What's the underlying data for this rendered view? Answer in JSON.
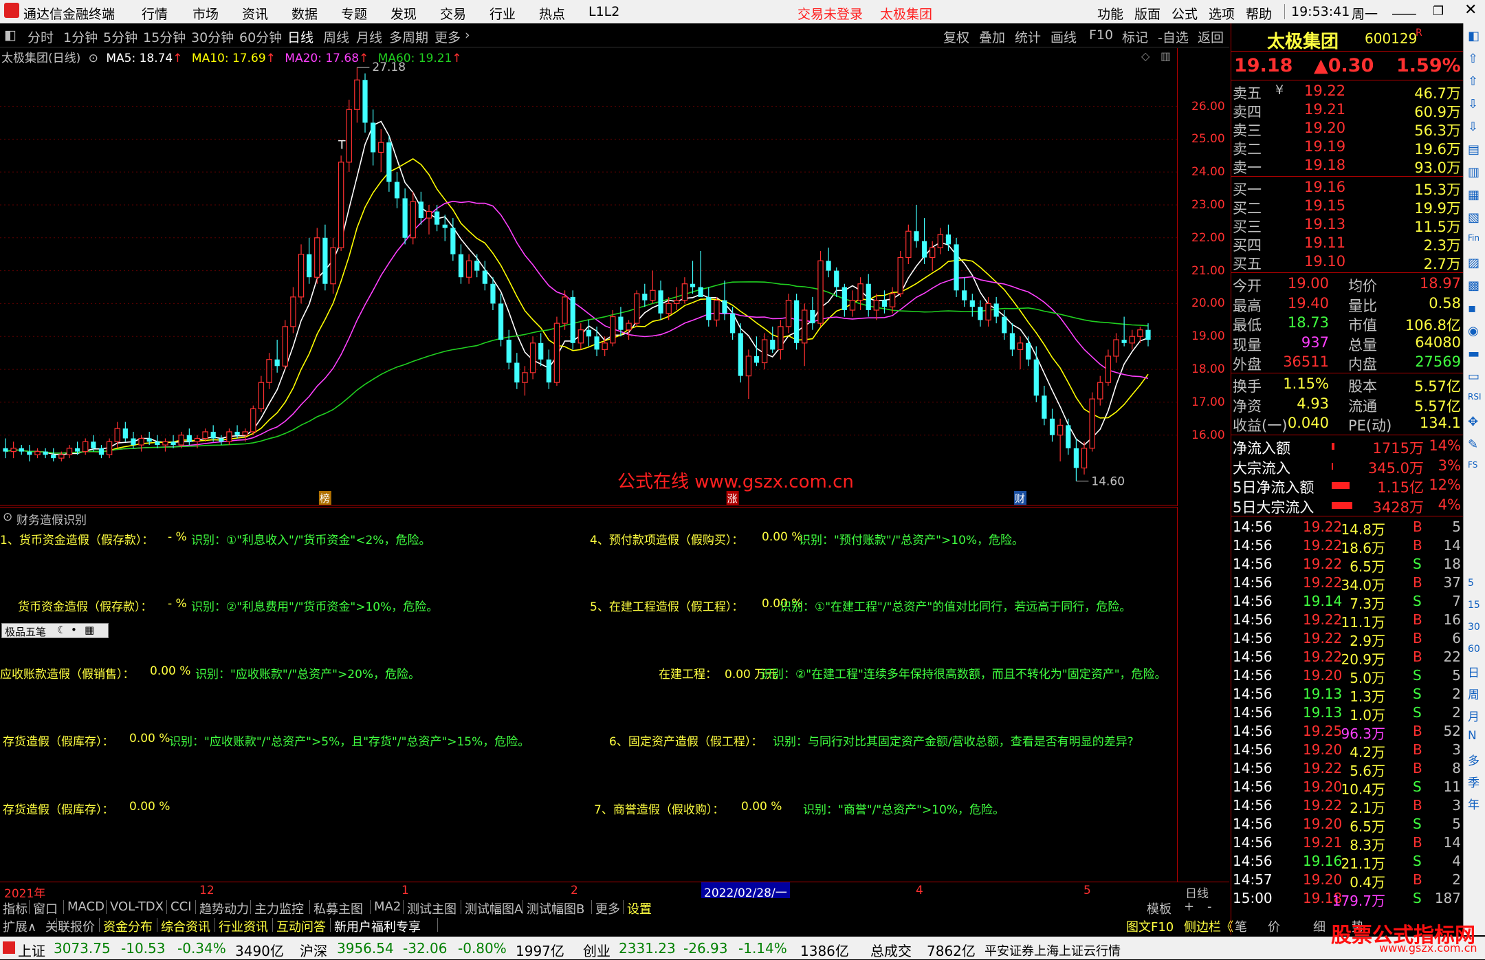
{
  "titlebar": {
    "app_title": "通达信金融终端",
    "menu": [
      "行情",
      "市场",
      "资讯",
      "数据",
      "专题",
      "发现",
      "交易",
      "行业",
      "热点",
      "L1L2"
    ],
    "login_status": "交易未登录",
    "stock_name": "太极集团",
    "right_menu": [
      "功能",
      "版面",
      "公式",
      "选项",
      "帮助"
    ],
    "time": "19:53:41",
    "weekday": "周一"
  },
  "periodbar": {
    "periods": [
      "分时",
      "1分钟",
      "5分钟",
      "15分钟",
      "30分钟",
      "60分钟",
      "日线",
      "周线",
      "月线",
      "多周期",
      "更多"
    ],
    "selected": "日线",
    "right_tools": [
      "复权",
      "叠加",
      "统计",
      "画线",
      "F10",
      "标记",
      "-自选",
      "返回"
    ]
  },
  "chart": {
    "info_name": "太极集团(日线)",
    "ma5": "MA5: 18.74",
    "ma10": "MA10: 17.69",
    "ma20": "MA20: 17.68",
    "ma60": "MA60: 19.21",
    "high_label": "27.18",
    "low_label": "14.60",
    "watermark_text": "公式在线  www.gszx.com.cn",
    "markers": [
      "榜",
      "涨",
      "财"
    ],
    "colors": {
      "up": "#ff3030",
      "down": "#40ffff",
      "ma5": "#ffffff",
      "ma10": "#ffff00",
      "ma20": "#ff40ff",
      "ma60": "#20d020"
    }
  },
  "chart_data": {
    "type": "candlestick",
    "title": "太极集团(日线)",
    "ylim": [
      15.0,
      27.5
    ],
    "yticks": [
      "26.00",
      "25.00",
      "24.00",
      "23.00",
      "22.00",
      "21.00",
      "20.00",
      "19.00",
      "18.00",
      "17.00",
      "16.00"
    ],
    "xticks": [
      "2021年",
      "12",
      "1",
      "2",
      "2022/02/28/一",
      "4",
      "5"
    ],
    "candles": [
      [
        15.6,
        15.9,
        15.3,
        15.5
      ],
      [
        15.5,
        15.8,
        15.3,
        15.6
      ],
      [
        15.6,
        15.7,
        15.4,
        15.5
      ],
      [
        15.5,
        15.7,
        15.2,
        15.4
      ],
      [
        15.4,
        15.6,
        15.3,
        15.5
      ],
      [
        15.5,
        15.6,
        15.3,
        15.4
      ],
      [
        15.4,
        15.6,
        15.2,
        15.3
      ],
      [
        15.3,
        15.5,
        15.2,
        15.4
      ],
      [
        15.4,
        15.7,
        15.3,
        15.6
      ],
      [
        15.6,
        15.8,
        15.4,
        15.5
      ],
      [
        15.5,
        15.9,
        15.4,
        15.8
      ],
      [
        15.8,
        16.0,
        15.5,
        15.6
      ],
      [
        15.6,
        15.7,
        15.3,
        15.4
      ],
      [
        15.4,
        15.9,
        15.3,
        15.8
      ],
      [
        15.8,
        16.4,
        15.6,
        16.2
      ],
      [
        16.2,
        16.4,
        15.8,
        15.9
      ],
      [
        15.9,
        16.1,
        15.6,
        15.7
      ],
      [
        15.7,
        16.0,
        15.5,
        15.9
      ],
      [
        15.9,
        16.1,
        15.7,
        15.8
      ],
      [
        15.8,
        16.0,
        15.6,
        15.7
      ],
      [
        15.7,
        15.9,
        15.5,
        15.8
      ],
      [
        15.8,
        16.0,
        15.6,
        15.7
      ],
      [
        15.7,
        16.1,
        15.6,
        16.0
      ],
      [
        16.0,
        16.2,
        15.7,
        15.8
      ],
      [
        15.8,
        16.0,
        15.6,
        15.9
      ],
      [
        15.9,
        16.2,
        15.8,
        16.1
      ],
      [
        16.1,
        16.3,
        15.8,
        15.9
      ],
      [
        15.9,
        16.0,
        15.7,
        15.8
      ],
      [
        15.8,
        16.2,
        15.7,
        16.1
      ],
      [
        16.1,
        16.3,
        15.9,
        16.0
      ],
      [
        16.0,
        16.2,
        15.8,
        16.1
      ],
      [
        16.1,
        16.9,
        16.0,
        16.8
      ],
      [
        16.8,
        17.8,
        16.7,
        17.6
      ],
      [
        17.6,
        18.5,
        17.4,
        18.3
      ],
      [
        18.3,
        18.9,
        17.9,
        18.1
      ],
      [
        18.1,
        19.5,
        18.0,
        19.3
      ],
      [
        19.3,
        20.5,
        19.1,
        20.2
      ],
      [
        20.2,
        21.8,
        20.0,
        21.5
      ],
      [
        21.5,
        22.0,
        20.6,
        20.8
      ],
      [
        20.8,
        22.3,
        20.6,
        22.0
      ],
      [
        22.0,
        22.4,
        20.4,
        20.6
      ],
      [
        20.6,
        22.0,
        20.3,
        21.7
      ],
      [
        21.7,
        24.5,
        21.6,
        24.3
      ],
      [
        24.3,
        26.2,
        24.0,
        25.9
      ],
      [
        25.9,
        27.18,
        25.5,
        26.8
      ],
      [
        26.8,
        27.0,
        25.2,
        25.5
      ],
      [
        25.5,
        25.9,
        24.2,
        24.6
      ],
      [
        24.6,
        25.3,
        24.0,
        24.9
      ],
      [
        24.9,
        25.1,
        23.4,
        23.7
      ],
      [
        23.7,
        24.0,
        22.9,
        23.2
      ],
      [
        23.2,
        23.5,
        21.8,
        22.0
      ],
      [
        22.0,
        23.4,
        21.8,
        23.1
      ],
      [
        23.1,
        23.4,
        22.4,
        22.6
      ],
      [
        22.6,
        23.0,
        22.1,
        22.8
      ],
      [
        22.8,
        23.0,
        22.2,
        22.4
      ],
      [
        22.4,
        22.7,
        21.9,
        22.3
      ],
      [
        22.3,
        22.6,
        21.3,
        21.5
      ],
      [
        21.5,
        21.8,
        20.6,
        20.8
      ],
      [
        20.8,
        21.5,
        20.6,
        21.3
      ],
      [
        21.3,
        21.5,
        20.8,
        21.0
      ],
      [
        21.0,
        21.3,
        20.4,
        20.6
      ],
      [
        20.6,
        20.8,
        19.8,
        20.0
      ],
      [
        20.0,
        20.3,
        18.7,
        18.9
      ],
      [
        18.9,
        19.2,
        18.0,
        18.2
      ],
      [
        18.2,
        18.5,
        17.4,
        17.6
      ],
      [
        17.6,
        18.1,
        17.2,
        17.9
      ],
      [
        17.9,
        19.0,
        17.7,
        18.8
      ],
      [
        18.8,
        19.1,
        18.1,
        18.3
      ],
      [
        18.3,
        18.6,
        17.4,
        17.6
      ],
      [
        17.6,
        19.6,
        17.5,
        19.4
      ],
      [
        19.4,
        20.4,
        19.2,
        20.2
      ],
      [
        20.2,
        20.4,
        18.6,
        18.8
      ],
      [
        18.8,
        19.4,
        18.6,
        19.2
      ],
      [
        19.2,
        19.5,
        18.7,
        19.0
      ],
      [
        19.0,
        19.3,
        18.4,
        18.6
      ],
      [
        18.6,
        19.0,
        18.4,
        18.8
      ],
      [
        18.8,
        19.8,
        18.7,
        19.6
      ],
      [
        19.6,
        19.9,
        19.0,
        19.2
      ],
      [
        19.2,
        19.5,
        18.9,
        19.4
      ],
      [
        19.4,
        20.4,
        19.3,
        20.3
      ],
      [
        20.3,
        20.6,
        19.9,
        20.1
      ],
      [
        20.1,
        21.0,
        20.0,
        20.4
      ],
      [
        20.4,
        20.7,
        19.5,
        19.7
      ],
      [
        19.7,
        20.2,
        19.5,
        20.0
      ],
      [
        20.0,
        20.5,
        19.8,
        20.1
      ],
      [
        20.1,
        20.8,
        20.0,
        20.6
      ],
      [
        20.6,
        21.3,
        20.3,
        20.5
      ],
      [
        20.5,
        21.6,
        20.4,
        20.2
      ],
      [
        20.2,
        20.5,
        19.3,
        19.5
      ],
      [
        19.5,
        20.2,
        19.3,
        20.1
      ],
      [
        20.1,
        20.7,
        19.5,
        19.7
      ],
      [
        19.7,
        19.9,
        18.9,
        19.1
      ],
      [
        19.1,
        19.4,
        17.6,
        17.8
      ],
      [
        17.8,
        18.6,
        17.1,
        18.4
      ],
      [
        18.4,
        19.0,
        18.1,
        18.2
      ],
      [
        18.2,
        19.1,
        18.0,
        18.9
      ],
      [
        18.9,
        19.3,
        18.5,
        18.6
      ],
      [
        18.6,
        19.5,
        18.3,
        19.3
      ],
      [
        19.3,
        20.3,
        19.1,
        20.1
      ],
      [
        20.1,
        20.3,
        18.6,
        18.8
      ],
      [
        18.8,
        20.0,
        18.1,
        19.8
      ],
      [
        19.8,
        20.2,
        19.2,
        19.4
      ],
      [
        19.4,
        21.6,
        19.3,
        21.3
      ],
      [
        21.3,
        21.7,
        20.8,
        21.0
      ],
      [
        21.0,
        21.1,
        20.2,
        20.5
      ],
      [
        20.5,
        20.6,
        19.6,
        19.8
      ],
      [
        19.8,
        20.4,
        19.6,
        20.1
      ],
      [
        20.1,
        20.8,
        19.8,
        20.6
      ],
      [
        20.6,
        20.9,
        19.6,
        19.8
      ],
      [
        19.8,
        20.3,
        19.5,
        20.1
      ],
      [
        20.1,
        20.4,
        19.7,
        19.9
      ],
      [
        19.9,
        20.5,
        19.7,
        20.3
      ],
      [
        20.3,
        21.6,
        20.2,
        21.4
      ],
      [
        21.4,
        22.4,
        21.2,
        22.2
      ],
      [
        22.2,
        23.0,
        21.7,
        21.9
      ],
      [
        21.9,
        22.6,
        21.2,
        21.4
      ],
      [
        21.4,
        21.9,
        21.0,
        21.7
      ],
      [
        21.7,
        22.3,
        21.5,
        22.1
      ],
      [
        22.1,
        22.4,
        21.6,
        21.8
      ],
      [
        21.8,
        22.0,
        20.2,
        20.4
      ],
      [
        20.4,
        20.8,
        19.9,
        20.1
      ],
      [
        20.1,
        20.3,
        19.6,
        19.9
      ],
      [
        19.9,
        20.1,
        19.3,
        19.5
      ],
      [
        19.5,
        20.2,
        19.3,
        20.0
      ],
      [
        20.0,
        20.2,
        19.4,
        19.6
      ],
      [
        19.6,
        19.8,
        18.9,
        19.1
      ],
      [
        19.1,
        19.4,
        18.4,
        18.6
      ],
      [
        18.6,
        19.0,
        18.0,
        18.8
      ],
      [
        18.8,
        19.0,
        18.1,
        18.3
      ],
      [
        18.3,
        18.7,
        17.0,
        17.2
      ],
      [
        17.2,
        17.5,
        16.3,
        16.5
      ],
      [
        16.5,
        16.8,
        15.8,
        16.0
      ],
      [
        16.0,
        16.5,
        15.2,
        16.3
      ],
      [
        16.3,
        16.5,
        15.4,
        15.6
      ],
      [
        15.6,
        15.9,
        14.6,
        15.0
      ],
      [
        15.0,
        15.8,
        14.8,
        15.6
      ],
      [
        15.6,
        17.3,
        15.5,
        17.1
      ],
      [
        17.1,
        17.8,
        16.9,
        17.6
      ],
      [
        17.6,
        18.6,
        17.5,
        18.4
      ],
      [
        18.4,
        19.1,
        18.2,
        18.9
      ],
      [
        18.9,
        19.6,
        18.7,
        18.8
      ],
      [
        18.8,
        19.2,
        18.6,
        19.0
      ],
      [
        19.0,
        19.3,
        18.8,
        19.2
      ],
      [
        19.2,
        19.4,
        18.7,
        18.9
      ]
    ],
    "ma5": [],
    "ma10": [],
    "ma20": [],
    "ma60": []
  },
  "indicator": {
    "panel_title": "财务造假识别",
    "lines": [
      {
        "label": "1、货币资金造假（假存款）：",
        "value": "- %",
        "rule": "识别：①\"利息收入\"/\"货币资金\"<2%，危险。"
      },
      {
        "label": "货币资金造假（假存款）：",
        "value": "- %",
        "rule": "识别：②\"利息费用\"/\"货币资金\">10%，危险。"
      },
      {
        "label": "应收账款造假（假销售）：",
        "value": "0.00 %",
        "rule": "识别：\"应收账款\"/\"总资产\">20%，危险。"
      },
      {
        "label": "存货造假（假库存）：",
        "value": "0.00 %",
        "rule": "识别：\"应收账款\"/\"总资产\">5%，且\"存货\"/\"总资产\">15%，危险。"
      },
      {
        "label": "存货造假（假库存）：",
        "value": "0.00 %",
        "rule": ""
      },
      {
        "label": "4、预付款项造假（假购买）：",
        "value": "0.00 %",
        "rule": "识别：\"预付账款\"/\"总资产\">10%，危险。"
      },
      {
        "label": "5、在建工程造假（假工程）：",
        "value": "0.00 %",
        "rule": "识别：①\"在建工程\"/\"总资产\"的值对比同行，若远高于同行，危险。"
      },
      {
        "label": "在建工程：",
        "value": "0.00 万元",
        "rule": "识别：②\"在建工程\"连续多年保持很高数额，而且不转化为\"固定资产\"，危险。"
      },
      {
        "label": "6、固定资产造假（假工程）：",
        "value": "",
        "rule": "识别：与同行对比其固定资产金额/营收总额，查看是否有明显的差异?"
      },
      {
        "label": "7、商誉造假（假收购）：",
        "value": "0.00 %",
        "rule": "识别：\"商誉\"/\"总资产\">10%，危险。"
      }
    ],
    "float_toolbar": "极品五笔"
  },
  "bottomaxis": {
    "labels": [
      "2021年",
      "12",
      "1",
      "2",
      "2022/02/28/一",
      "4",
      "5"
    ],
    "right": "日线"
  },
  "tabs1": [
    "指标",
    "窗口",
    "MACD",
    "VOL-TDX",
    "CCI",
    "趋势动力",
    "主力监控",
    "私募主图",
    "MA2",
    "测试主图",
    "测试幅图A",
    "测试幅图B",
    "更多",
    "设置"
  ],
  "tabs1_right": [
    "模板",
    "+",
    "-"
  ],
  "tabs2": [
    "扩展∧",
    "关联报价",
    "资金分布",
    "综合资讯",
    "行业资讯",
    "互动问答",
    "新用户福利专享"
  ],
  "tabs2_right": [
    "图文F10",
    "侧边栏《",
    "笔",
    "价",
    "细",
    "势"
  ],
  "statusbar": {
    "items": [
      {
        "name": "上证",
        "price": "3073.75",
        "chg": "-10.53",
        "pct": "-0.34%",
        "amt": "3490亿"
      },
      {
        "name": "沪深",
        "price": "3956.54",
        "chg": "-32.06",
        "pct": "-0.80%",
        "amt": "1997亿"
      },
      {
        "name": "创业",
        "price": "2331.23",
        "chg": "-26.93",
        "pct": "-1.14%",
        "amt": "1386亿"
      }
    ],
    "total_label": "总成交",
    "total": "7862亿",
    "server": "平安证券上海上证云行情"
  },
  "quote": {
    "name": "太极集团",
    "code": "600129",
    "flag": "R",
    "price": "19.18",
    "change": "▲0.30",
    "pct": "1.59%",
    "asks": [
      {
        "label": "卖五",
        "price": "19.22",
        "vol": "46.7万"
      },
      {
        "label": "卖四",
        "price": "19.21",
        "vol": "60.9万"
      },
      {
        "label": "卖三",
        "price": "19.20",
        "vol": "56.3万"
      },
      {
        "label": "卖二",
        "price": "19.19",
        "vol": "19.6万"
      },
      {
        "label": "卖一",
        "price": "19.18",
        "vol": "93.0万"
      }
    ],
    "bids": [
      {
        "label": "买一",
        "price": "19.16",
        "vol": "15.3万"
      },
      {
        "label": "买二",
        "price": "19.15",
        "vol": "19.9万"
      },
      {
        "label": "买三",
        "price": "19.13",
        "vol": "11.5万"
      },
      {
        "label": "买四",
        "price": "19.11",
        "vol": "2.3万"
      },
      {
        "label": "买五",
        "price": "19.10",
        "vol": "2.7万"
      }
    ],
    "stats": [
      {
        "l1": "今开",
        "v1": "19.00",
        "l2": "均价",
        "v2": "18.97"
      },
      {
        "l1": "最高",
        "v1": "19.40",
        "l2": "量比",
        "v2": "0.58"
      },
      {
        "l1": "最低",
        "v1": "18.73",
        "l2": "市值",
        "v2": "106.8亿"
      },
      {
        "l1": "现量",
        "v1": "937",
        "l2": "总量",
        "v2": "64080"
      },
      {
        "l1": "外盘",
        "v1": "36511",
        "l2": "内盘",
        "v2": "27569"
      }
    ],
    "stats2": [
      {
        "l1": "换手",
        "v1": "1.15%",
        "l2": "股本",
        "v2": "5.57亿"
      },
      {
        "l1": "净资",
        "v1": "4.93",
        "l2": "流通",
        "v2": "5.57亿"
      },
      {
        "l1": "收益(一)",
        "v1": "0.040",
        "l2": "PE(动)",
        "v2": "134.1"
      }
    ],
    "flows": [
      {
        "label": "净流入额",
        "value": "1715万",
        "pct": "14%"
      },
      {
        "label": "大宗流入",
        "value": "345.0万",
        "pct": "3%"
      },
      {
        "label": "5日净流入额",
        "value": "1.15亿",
        "pct": "12%"
      },
      {
        "label": "5日大宗流入",
        "value": "3428万",
        "pct": "4%"
      }
    ],
    "ticks": [
      {
        "t": "14:56",
        "p": "19.22",
        "v": "14.8万",
        "d": "B",
        "n": "5"
      },
      {
        "t": "14:56",
        "p": "19.22",
        "v": "18.6万",
        "d": "B",
        "n": "14"
      },
      {
        "t": "14:56",
        "p": "19.22",
        "v": "6.5万",
        "d": "S",
        "n": "18"
      },
      {
        "t": "14:56",
        "p": "19.22",
        "v": "34.0万",
        "d": "B",
        "n": "37"
      },
      {
        "t": "14:56",
        "p": "19.14",
        "v": "7.3万",
        "d": "S",
        "n": "7"
      },
      {
        "t": "14:56",
        "p": "19.22",
        "v": "11.1万",
        "d": "B",
        "n": "16"
      },
      {
        "t": "14:56",
        "p": "19.22",
        "v": "2.9万",
        "d": "B",
        "n": "6"
      },
      {
        "t": "14:56",
        "p": "19.22",
        "v": "20.9万",
        "d": "B",
        "n": "22"
      },
      {
        "t": "14:56",
        "p": "19.20",
        "v": "5.0万",
        "d": "S",
        "n": "5"
      },
      {
        "t": "14:56",
        "p": "19.13",
        "v": "1.3万",
        "d": "S",
        "n": "2"
      },
      {
        "t": "14:56",
        "p": "19.13",
        "v": "1.0万",
        "d": "S",
        "n": "2"
      },
      {
        "t": "14:56",
        "p": "19.25",
        "v": "96.3万",
        "d": "B",
        "n": "52"
      },
      {
        "t": "14:56",
        "p": "19.20",
        "v": "4.2万",
        "d": "B",
        "n": "3"
      },
      {
        "t": "14:56",
        "p": "19.22",
        "v": "5.6万",
        "d": "B",
        "n": "8"
      },
      {
        "t": "14:56",
        "p": "19.20",
        "v": "10.4万",
        "d": "S",
        "n": "11"
      },
      {
        "t": "14:56",
        "p": "19.22",
        "v": "2.1万",
        "d": "B",
        "n": "3"
      },
      {
        "t": "14:56",
        "p": "19.20",
        "v": "6.5万",
        "d": "S",
        "n": "5"
      },
      {
        "t": "14:56",
        "p": "19.21",
        "v": "8.3万",
        "d": "B",
        "n": "14"
      },
      {
        "t": "14:56",
        "p": "19.16",
        "v": "21.1万",
        "d": "S",
        "n": "4"
      },
      {
        "t": "14:57",
        "p": "19.20",
        "v": "0.4万",
        "d": "B",
        "n": "2"
      },
      {
        "t": "15:00",
        "p": "19.18",
        "v": "179.7万",
        "d": "S",
        "n": "187"
      }
    ]
  },
  "sidebar_right": [
    "日",
    "周",
    "月",
    "N",
    "多",
    "季",
    "年"
  ],
  "sidebar_right_small": [
    "5",
    "15",
    "30",
    "60"
  ],
  "watermark_logo": "股票公式指标网",
  "watermark_logo_url": "www.gszx.com.cn"
}
